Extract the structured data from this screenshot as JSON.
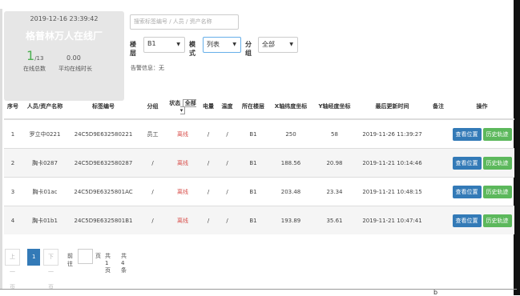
{
  "stats": {
    "datetime": "2019-12-16 23:39:42",
    "title": "格普林万人在线厂",
    "online": "1",
    "online_total": "/13",
    "avg": "0.00",
    "online_label": "在线总数",
    "avg_label": "平均在线时长"
  },
  "search": {
    "placeholder": "搜索标签编号 / 人员 / 资产名称"
  },
  "filters": {
    "floor_label": "楼层",
    "floor_value": "B1",
    "mode_label": "模式",
    "mode_value": "列表",
    "group_label": "分组",
    "group_value": "全部"
  },
  "warning": "告警信息：无",
  "table": {
    "headers": [
      "序号",
      "人员/资产名称",
      "标签编号",
      "分组",
      "状态",
      "电量",
      "温度",
      "所在楼层",
      "X轴纬度坐标",
      "Y轴经度坐标",
      "最后更新时间",
      "备注",
      "操作"
    ],
    "state_filter": "全部",
    "rows": [
      [
        "1",
        "罗立中0221",
        "24C5D9E632580221",
        "员工",
        "离线",
        "/",
        "/",
        "B1",
        "250",
        "58",
        "2019-11-26 11:39:27",
        ""
      ],
      [
        "2",
        "胸卡0287",
        "24C5D9E632580287",
        "/",
        "离线",
        "/",
        "/",
        "B1",
        "188.56",
        "20.98",
        "2019-11-21 10:14:46",
        ""
      ],
      [
        "3",
        "胸卡01ac",
        "24C5D9E6325801AC",
        "/",
        "离线",
        "/",
        "/",
        "B1",
        "203.48",
        "23.34",
        "2019-11-21 10:48:15",
        ""
      ],
      [
        "4",
        "胸卡01b1",
        "24C5D9E6325801B1",
        "/",
        "离线",
        "/",
        "/",
        "B1",
        "193.89",
        "35.61",
        "2019-11-21 10:47:41",
        ""
      ]
    ],
    "btn_locate": "查看位置",
    "btn_history": "历史轨迹"
  },
  "pager": {
    "prev": "上一页",
    "current": "1",
    "next": "下一页",
    "goto": "前往",
    "unit": "页",
    "total_pages": "共1页",
    "total_items": "共 4 条"
  },
  "corner": "b"
}
